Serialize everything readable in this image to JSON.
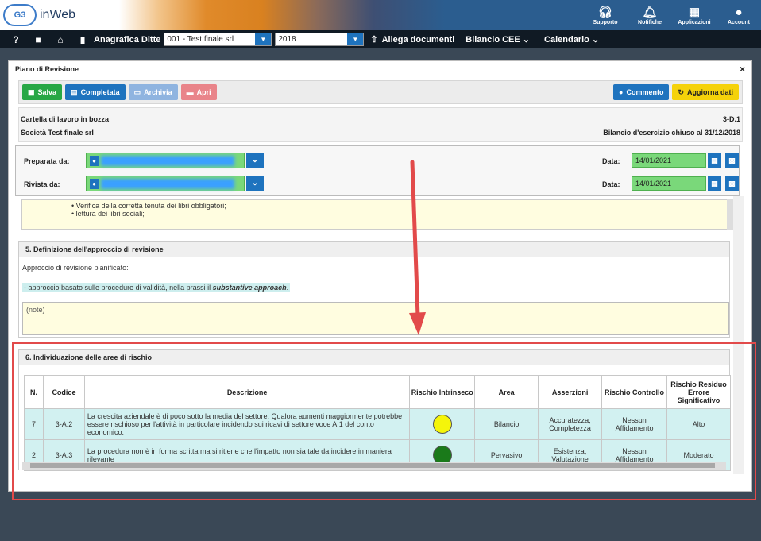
{
  "header": {
    "logo_badge": "G3",
    "logo_text": "inWeb",
    "icons": [
      {
        "name": "headset-icon",
        "label": "Supporto"
      },
      {
        "name": "bell-icon",
        "label": "Notifiche"
      },
      {
        "name": "grid-icon",
        "label": "Applicazioni"
      },
      {
        "name": "user-icon",
        "label": "Account"
      }
    ]
  },
  "nav": {
    "help": "?",
    "company_label": "Anagrafica Ditte",
    "company_value": "001 - Test finale srl",
    "year_value": "2018",
    "attach": "Allega documenti",
    "bilancio": "Bilancio CEE",
    "calendario": "Calendario"
  },
  "modal": {
    "title": "Piano di Revisione",
    "close": "×"
  },
  "toolbar": {
    "salva": "Salva",
    "completata": "Completata",
    "archivia": "Archivia",
    "apri": "Apri",
    "commento": "Commento",
    "aggiorna": "Aggiorna dati"
  },
  "info": {
    "status": "Cartella di lavoro in bozza",
    "code": "3-D.1",
    "company": "Società Test finale srl",
    "period": "Bilancio d'esercizio chiuso al 31/12/2018"
  },
  "prep": {
    "preparata_label": "Preparata da:",
    "rivista_label": "Rivista da:",
    "data_label": "Data:",
    "date1": "14/01/2021",
    "date2": "14/01/2021"
  },
  "list": {
    "item1": "• Verifica della corretta tenuta dei libri obbligatori;",
    "item2": "• lettura dei libri sociali;"
  },
  "section5": {
    "title": "5. Definizione dell'approccio di revisione",
    "subtitle": "Approccio di revisione pianificato:",
    "approach_prefix": "- approccio basato sulle procedure di validità, nella prassi il ",
    "approach_em": "substantive approach",
    "approach_suffix": ".",
    "notes": "(note)"
  },
  "section6": {
    "title": "6. Individuazione delle aree di rischio",
    "columns": [
      "N.",
      "Codice",
      "Descrizione",
      "Rischio Intrinseco",
      "Area",
      "Asserzioni",
      "Rischio Controllo",
      "Rischio Residuo Errore Significativo"
    ],
    "rows": [
      {
        "n": "7",
        "code": "3-A.2",
        "desc": "La crescita aziendale è di poco sotto la media del settore. Qualora aumenti maggiormente potrebbe essere rischioso per l'attività in particolare incidendo sui ricavi di settore voce A.1 del conto economico.",
        "risk_color": "#f5f50a",
        "area": "Bilancio",
        "assertions": "Accuratezza, Completezza",
        "control": "Nessun Affidamento",
        "residual": "Alto"
      },
      {
        "n": "2",
        "code": "3-A.3",
        "desc": "La procedura non è in forma scritta ma si ritiene che l'impatto non sia tale da incidere in maniera rilevante",
        "risk_color": "#1a7a1a",
        "area": "Pervasivo",
        "assertions": "Esistenza, Valutazione",
        "control": "Nessun Affidamento",
        "residual": "Moderato"
      }
    ]
  },
  "colors": {
    "green": "#28a745",
    "blue": "#1e73be",
    "archivia": "#8fb4e0",
    "apri": "#e9848a",
    "aggiorna": "#f5d20a",
    "highlight": "#e24a4a"
  }
}
